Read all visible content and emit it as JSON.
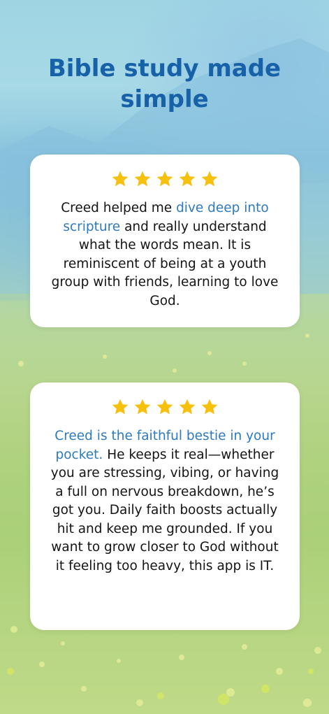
{
  "page": {
    "title": "Bible study made simple"
  },
  "reviews": [
    {
      "rating": 5,
      "highlight": "dive deep into scripture",
      "pre": "Creed helped me ",
      "post": " and really understand what the words mean. It is reminiscent of being at a youth group with friends, learning to love God."
    },
    {
      "rating": 5,
      "pre": "",
      "highlight": "Creed is the faithful bestie in your pocket.",
      "post": " He keeps it real—whether you are stressing, vibing, or having a full on nervous breakdown, he’s got you. Daily faith boosts actually hit and keep me grounded. If you want to grow closer to God without it feeling too heavy, this app is IT."
    }
  ],
  "colors": {
    "title": "#1661a8",
    "highlight": "#2d7ac0",
    "star": "#f6c10e",
    "card": "#ffffff",
    "text": "#141414"
  },
  "icons": {
    "rating": "star-icon"
  }
}
